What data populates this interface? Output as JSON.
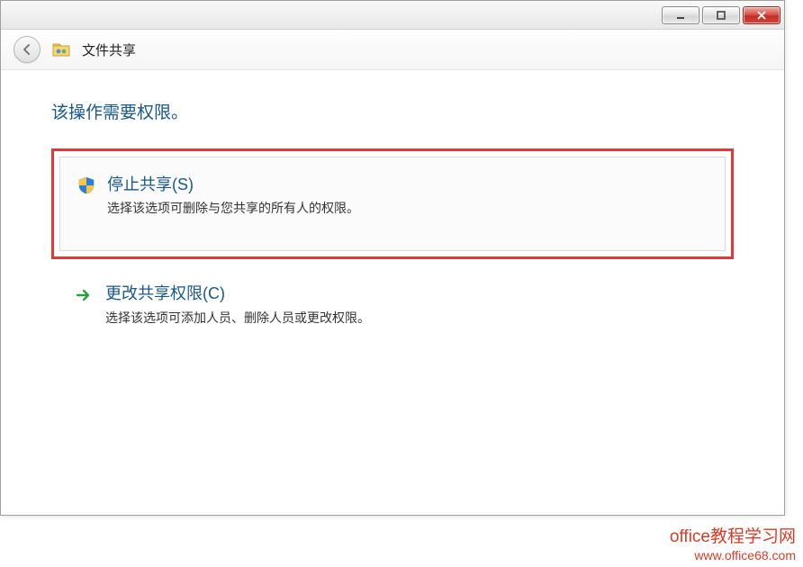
{
  "window": {
    "title": "文件共享"
  },
  "main": {
    "heading": "该操作需要权限。",
    "option1": {
      "title": "停止共享(S)",
      "desc": "选择该选项可删除与您共享的所有人的权限。"
    },
    "option2": {
      "title": "更改共享权限(C)",
      "desc": "选择该选项可添加人员、删除人员或更改权限。"
    }
  },
  "watermark": {
    "line1": "office教程学习网",
    "line2": "www.office68.com"
  }
}
